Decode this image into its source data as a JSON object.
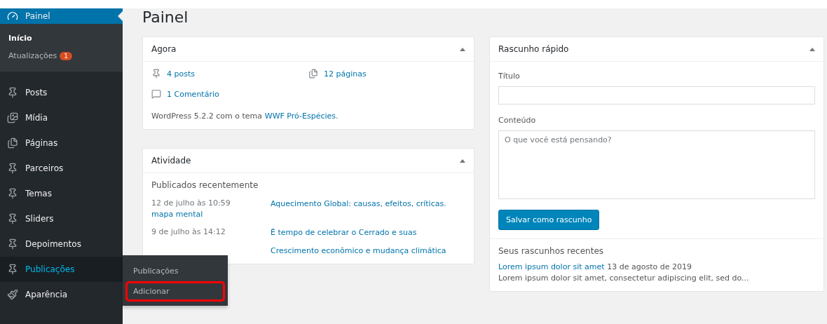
{
  "sidebar": {
    "items": [
      {
        "label": "Painel",
        "kind": "dashboard",
        "selected": true,
        "hovered": false,
        "children": [
          {
            "label": "Início",
            "selected": true
          },
          {
            "label": "Atualizações",
            "selected": false,
            "badge": "1"
          }
        ]
      },
      {
        "label": "Posts",
        "kind": "pin",
        "selected": false,
        "hovered": false
      },
      {
        "label": "Mídia",
        "kind": "media",
        "selected": false,
        "hovered": false
      },
      {
        "label": "Páginas",
        "kind": "pages",
        "selected": false,
        "hovered": false
      },
      {
        "label": "Parceiros",
        "kind": "pin",
        "selected": false,
        "hovered": false
      },
      {
        "label": "Temas",
        "kind": "pin",
        "selected": false,
        "hovered": false
      },
      {
        "label": "Sliders",
        "kind": "pin",
        "selected": false,
        "hovered": false
      },
      {
        "label": "Depoimentos",
        "kind": "pin",
        "selected": false,
        "hovered": false
      },
      {
        "label": "Publicações",
        "kind": "pin",
        "selected": false,
        "hovered": true,
        "flyout": [
          {
            "label": "Publicações",
            "highlighted": false
          },
          {
            "label": "Adicionar",
            "highlighted": true
          }
        ]
      },
      {
        "label": "Aparência",
        "kind": "brush",
        "selected": false,
        "hovered": false
      }
    ]
  },
  "page_title": "Painel",
  "at_a_glance": {
    "title": "Agora",
    "stats": [
      {
        "kind": "posts",
        "label": "4 posts"
      },
      {
        "kind": "pages",
        "label": "12 páginas"
      },
      {
        "kind": "comments",
        "label": "1 Comentário"
      }
    ],
    "version_text": "WordPress 5.2.2 com o tema",
    "theme_link": "WWF Pró-Espécies."
  },
  "activity": {
    "title": "Atividade",
    "section": "Publicados recentemente",
    "rows": [
      {
        "date": "12 de julho às 10:59",
        "title": "Aquecimento Global: causas, efeitos, críticas.",
        "continuation": "mapa mental"
      },
      {
        "date": "9 de julho às 14:12",
        "title": "É tempo de celebrar o Cerrado e suas"
      },
      {
        "title": "Crescimento econômico e mudança climática"
      }
    ]
  },
  "quick_draft": {
    "title": "Rascunho rápido",
    "title_label": "Título",
    "content_label": "Conteúdo",
    "content_placeholder": "O que você está pensando?",
    "button": "Salvar como rascunho",
    "recent_heading": "Seus rascunhos recentes",
    "drafts": [
      {
        "title": "Lorem ipsum dolor sit amet",
        "date": "13 de agosto de 2019",
        "excerpt": "Lorem ipsum dolor sit amet, consectetur adipiscing elit, sed do..."
      }
    ]
  }
}
